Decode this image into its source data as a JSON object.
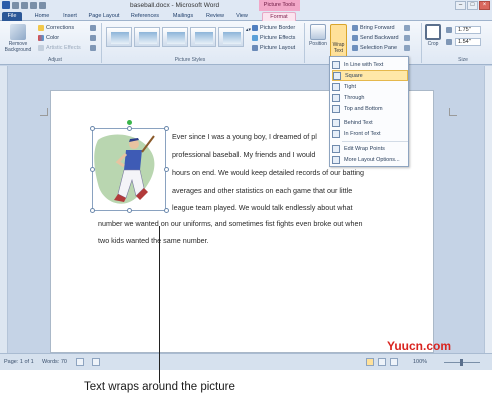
{
  "window": {
    "title": "baseball.docx - Microsoft Word",
    "context_group": "Picture Tools",
    "buttons": {
      "minimize": "–",
      "maximize": "□",
      "close": "×"
    }
  },
  "tabs": [
    "File",
    "Home",
    "Insert",
    "Page Layout",
    "References",
    "Mailings",
    "Review",
    "View",
    "Format"
  ],
  "active_tab": "Format",
  "ribbon": {
    "adjust": {
      "remove_background": "Remove Background",
      "corrections": "Corrections",
      "color": "Color",
      "artistic_effects": "Artistic Effects",
      "label": "Adjust"
    },
    "picture_styles": {
      "label": "Picture Styles",
      "picture_border": "Picture Border",
      "picture_effects": "Picture Effects",
      "picture_layout": "Picture Layout"
    },
    "arrange": {
      "position": "Position",
      "wrap_text": "Wrap Text",
      "bring_forward": "Bring Forward",
      "send_backward": "Send Backward",
      "selection_pane": "Selection Pane"
    },
    "size": {
      "crop": "Crop",
      "height": "1.75\"",
      "width": "1.54\"",
      "label": "Size"
    }
  },
  "wrap_menu": [
    "In Line with Text",
    "Square",
    "Tight",
    "Through",
    "Top and Bottom",
    "Behind Text",
    "In Front of Text",
    "Edit Wrap Points",
    "More Layout Options..."
  ],
  "wrap_menu_selected": "Square",
  "document": {
    "lines": [
      "Ever since I was a young boy, I dreamed of pl",
      "professional baseball.  My friends and I would",
      "hours on end.  We would keep detailed records of our batting",
      "averages and other statistics on each game that our little",
      "league team played.  We would talk endlessly about what",
      "number we wanted on our uniforms, and sometimes fist fights even broke out when",
      "two kids wanted the same number."
    ]
  },
  "status_bar": {
    "page": "Page: 1 of 1",
    "words": "Words: 70",
    "zoom": "100%"
  },
  "watermark": "Yuucn.com",
  "caption": "Text wraps around the picture"
}
